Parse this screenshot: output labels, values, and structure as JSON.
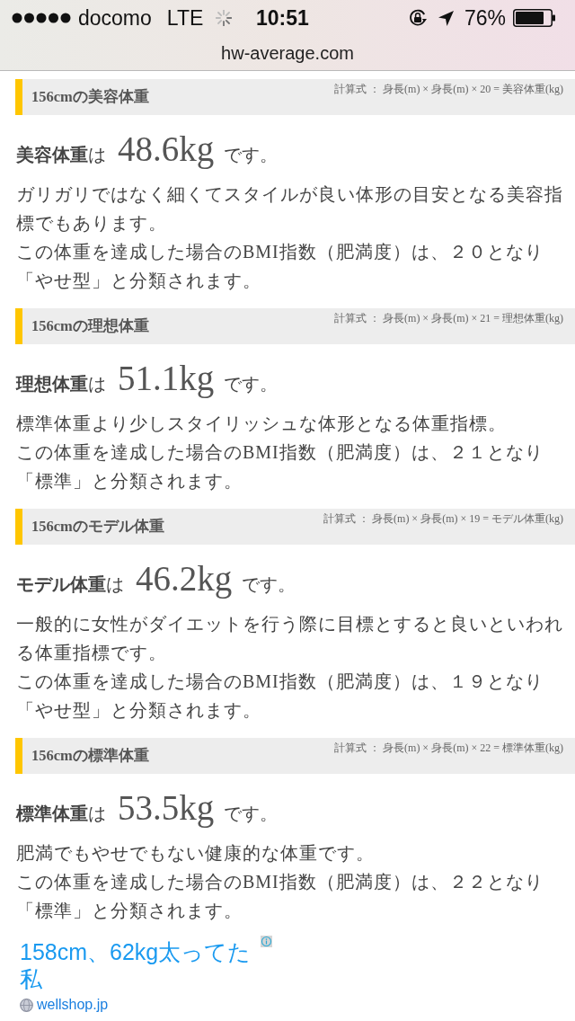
{
  "status_bar": {
    "carrier": "docomo",
    "network": "LTE",
    "time": "10:51",
    "battery": "76%"
  },
  "address_bar": {
    "url": "hw-average.com"
  },
  "sections": [
    {
      "title": "156cmの美容体重",
      "formula": "計算式 ： 身長(m) × 身長(m) × 20 = 美容体重(kg)",
      "result": {
        "label": "美容体重",
        "connector": "は",
        "value": "48.6kg",
        "ending": "です。"
      },
      "description": [
        "ガリガリではなく細くてスタイルが良い体形の目安となる美容指標でもあります。",
        "この体重を達成した場合のBMI指数（肥満度）は、２０となり「やせ型」と分類されます。"
      ]
    },
    {
      "title": "156cmの理想体重",
      "formula": "計算式 ： 身長(m) × 身長(m) × 21 = 理想体重(kg)",
      "result": {
        "label": "理想体重",
        "connector": "は",
        "value": "51.1kg",
        "ending": "です。"
      },
      "description": [
        "標準体重より少しスタイリッシュな体形となる体重指標。",
        "この体重を達成した場合のBMI指数（肥満度）は、２１となり「標準」と分類されます。"
      ]
    },
    {
      "title": "156cmのモデル体重",
      "formula": "計算式 ： 身長(m) × 身長(m) × 19 = モデル体重(kg)",
      "result": {
        "label": "モデル体重",
        "connector": "は",
        "value": "46.2kg",
        "ending": "です。"
      },
      "description": [
        "一般的に女性がダイエットを行う際に目標とすると良いといわれる体重指標です。",
        "この体重を達成した場合のBMI指数（肥満度）は、１９となり「やせ型」と分類されます。"
      ]
    },
    {
      "title": "156cmの標準体重",
      "formula": "計算式 ： 身長(m) × 身長(m) × 22 = 標準体重(kg)",
      "result": {
        "label": "標準体重",
        "connector": "は",
        "value": "53.5kg",
        "ending": "です。"
      },
      "description": [
        "肥満でもやせでもない健康的な体重です。",
        "この体重を達成した場合のBMI指数（肥満度）は、２２となり「標準」と分類されます。"
      ]
    }
  ],
  "ad": {
    "title": "158cm、62kg太ってた私",
    "domain": "wellshop.jp"
  }
}
